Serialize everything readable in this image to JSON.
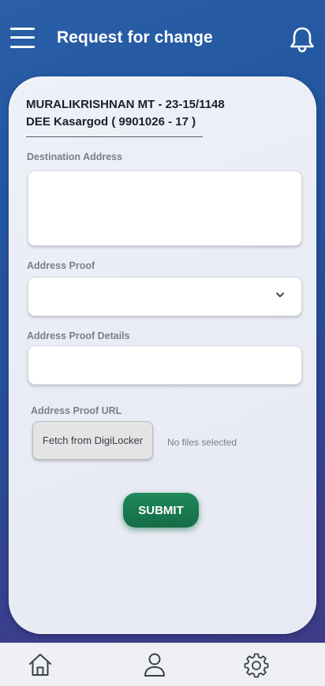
{
  "header": {
    "title": "Request for change",
    "menu_icon": "hamburger-menu-icon",
    "notification_icon": "bell-icon"
  },
  "user": {
    "name_line": "MURALIKRISHNAN MT - 23-15/1148",
    "office_line": "DEE Kasargod ( 9901026 - 17 )"
  },
  "form": {
    "destination_address": {
      "label": "Destination Address",
      "value": ""
    },
    "address_proof": {
      "label": "Address Proof",
      "selected": "",
      "icon": "chevron-down-icon"
    },
    "address_proof_details": {
      "label": "Address Proof Details",
      "value": ""
    },
    "address_proof_url": {
      "label": "Address Proof URL",
      "button_label": "Fetch from DigiLocker",
      "status": "No files selected"
    },
    "submit_label": "SUBMIT"
  },
  "bottom_nav": {
    "items": [
      {
        "icon": "home-icon"
      },
      {
        "icon": "profile-icon"
      },
      {
        "icon": "settings-icon"
      }
    ]
  },
  "colors": {
    "background_top": "#2a5fa8",
    "background_bottom": "#3f3a86",
    "submit_green": "#1a7a50",
    "card": "#eef1f7"
  }
}
